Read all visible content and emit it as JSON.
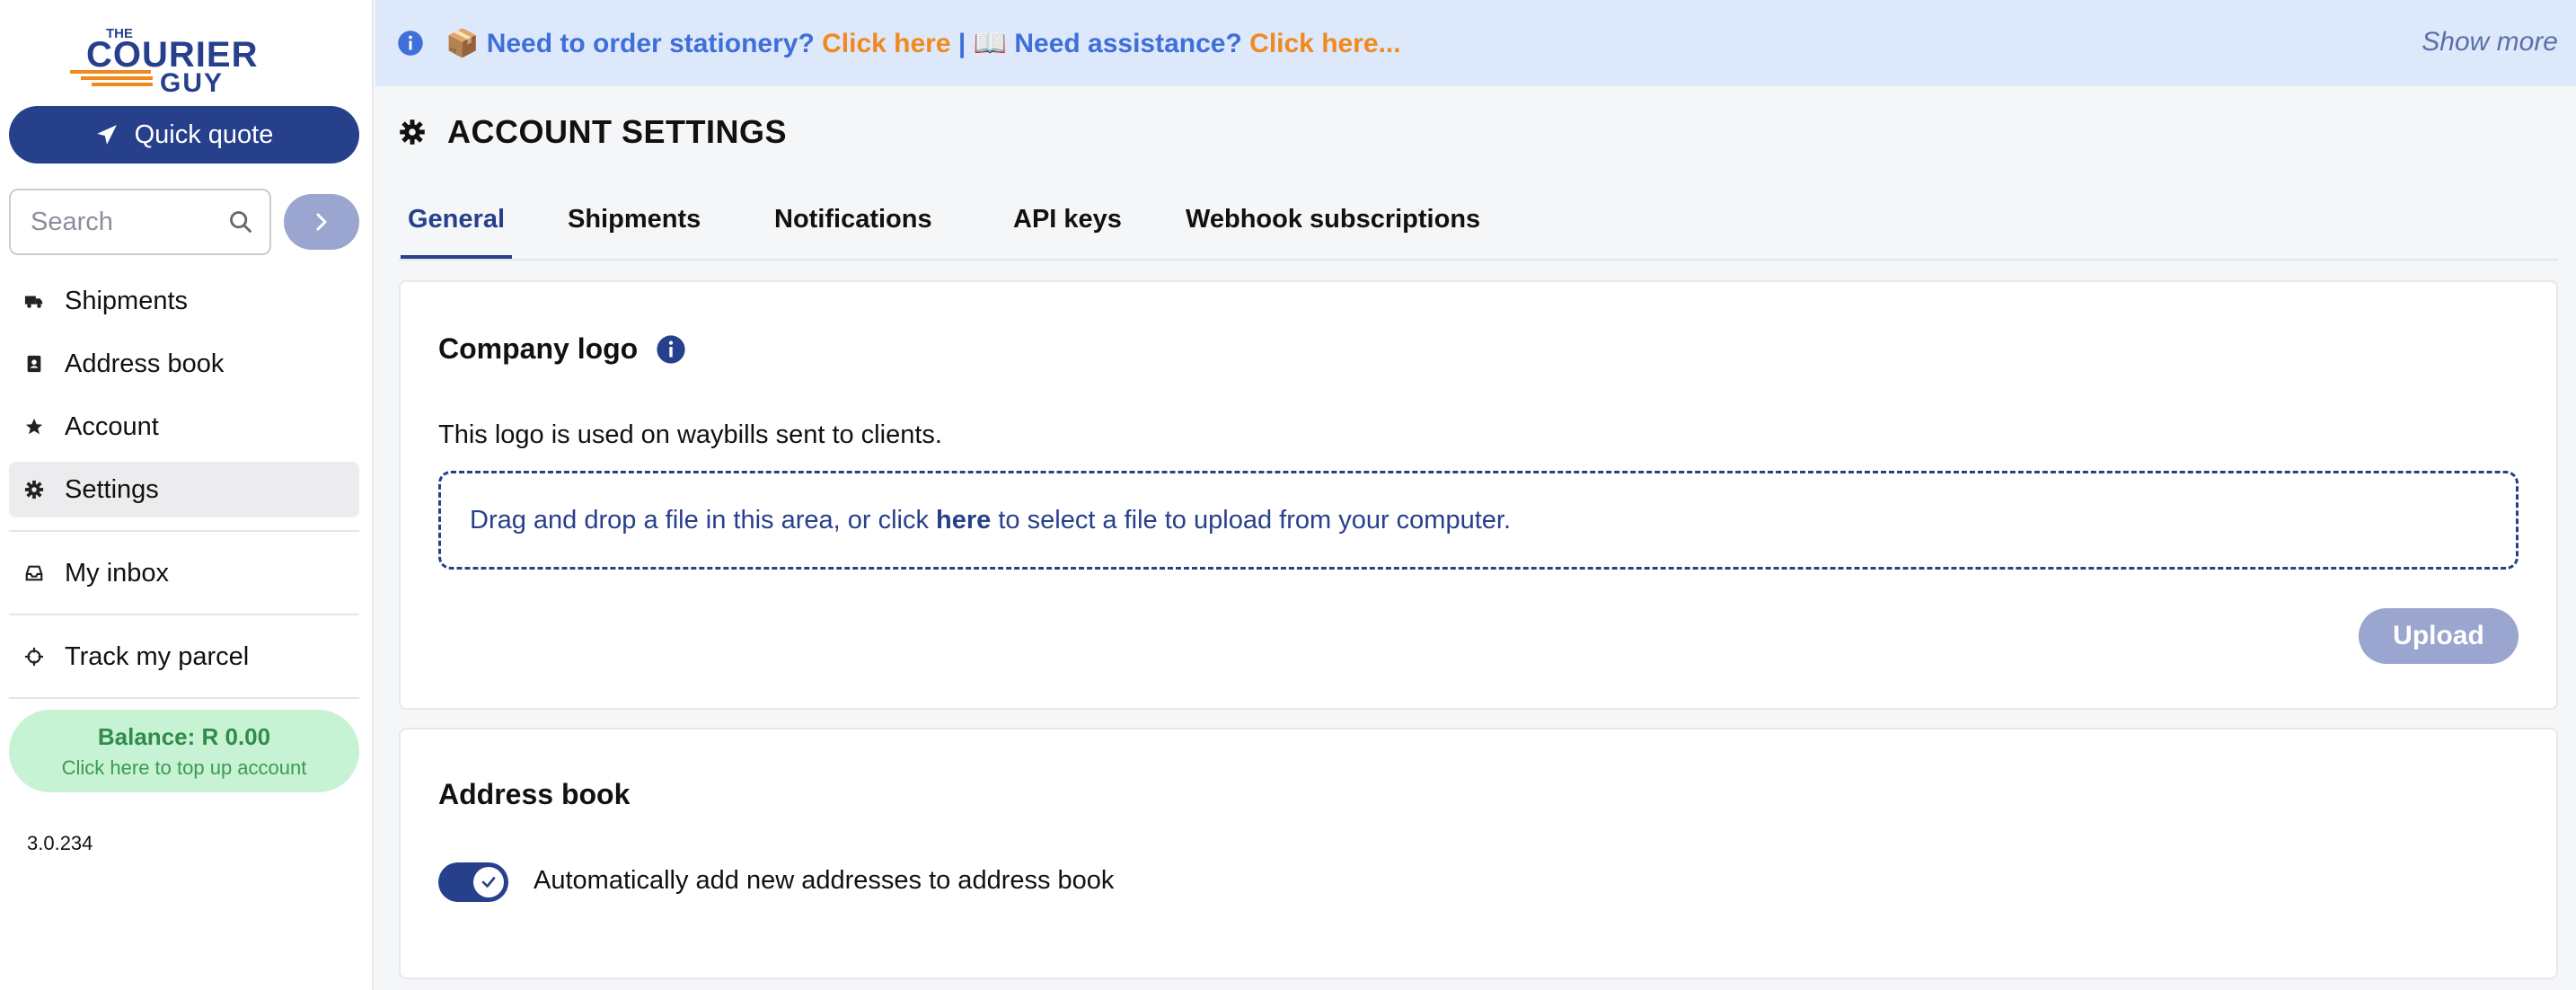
{
  "brand": {
    "logo_text_top": "THE",
    "logo_text_main": "COURIER",
    "logo_text_bottom": "GUY",
    "primary_color": "#27408b",
    "accent_color": "#f0891e"
  },
  "sidebar": {
    "quick_quote_label": "Quick quote",
    "quick_quote_icon": "paper-plane-icon",
    "search_placeholder": "Search",
    "search_icon": "search-icon",
    "search_go_icon": "chevron-right-icon",
    "items": [
      {
        "label": "Shipments",
        "icon": "truck-icon",
        "active": false
      },
      {
        "label": "Address book",
        "icon": "address-book-icon",
        "active": false
      },
      {
        "label": "Account",
        "icon": "star-icon",
        "active": false
      },
      {
        "label": "Settings",
        "icon": "gear-icon",
        "active": true
      },
      {
        "label": "My inbox",
        "icon": "inbox-icon",
        "active": false
      },
      {
        "label": "Track my parcel",
        "icon": "crosshair-icon",
        "active": false
      }
    ],
    "balance": {
      "label": "Balance: R 0.00",
      "subtitle": "Click here to top up account"
    },
    "version": "3.0.234"
  },
  "banner": {
    "box_emoji": "📦",
    "text_1": "Need to order stationery?",
    "link_1": "Click here",
    "separator": "|",
    "book_emoji": "📖",
    "text_2": "Need assistance?",
    "link_2": "Click here...",
    "show_more": "Show more",
    "background_color": "#dde8fb"
  },
  "main": {
    "page_title": "ACCOUNT SETTINGS",
    "tabs": [
      {
        "label": "General",
        "active": true
      },
      {
        "label": "Shipments",
        "active": false
      },
      {
        "label": "Notifications",
        "active": false
      },
      {
        "label": "API keys",
        "active": false
      },
      {
        "label": "Webhook subscriptions",
        "active": false
      }
    ],
    "company_logo": {
      "title": "Company logo",
      "description": "This logo is used on waybills sent to clients.",
      "dropzone_before": "Drag and drop a file in this area, or click",
      "dropzone_link": "here",
      "dropzone_after": "to select a file to upload from your computer.",
      "upload_label": "Upload"
    },
    "address_book": {
      "title": "Address book",
      "toggle_label": "Automatically add new addresses to address book",
      "toggle_on": true
    }
  }
}
